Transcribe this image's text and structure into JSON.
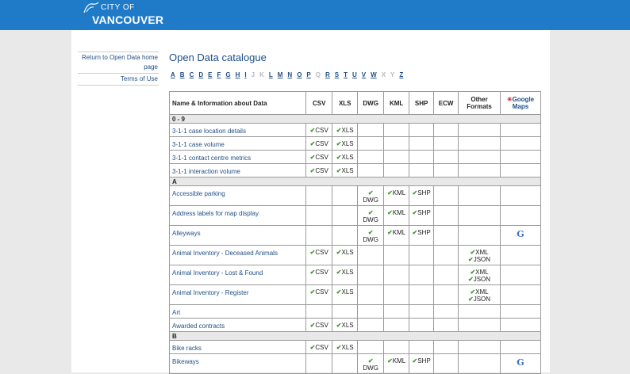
{
  "header": {
    "logo_top": "CITY OF",
    "logo_bottom": "VANCOUVER"
  },
  "sidebar": {
    "links": [
      "Return to Open Data home page",
      "Terms of Use"
    ]
  },
  "page_title": "Open Data catalogue",
  "alphabet": [
    {
      "l": "A",
      "on": true
    },
    {
      "l": "B",
      "on": true
    },
    {
      "l": "C",
      "on": true
    },
    {
      "l": "D",
      "on": true
    },
    {
      "l": "E",
      "on": true
    },
    {
      "l": "F",
      "on": true
    },
    {
      "l": "G",
      "on": true
    },
    {
      "l": "H",
      "on": true
    },
    {
      "l": "I",
      "on": true
    },
    {
      "l": "J",
      "on": false
    },
    {
      "l": "K",
      "on": false
    },
    {
      "l": "L",
      "on": true
    },
    {
      "l": "M",
      "on": true
    },
    {
      "l": "N",
      "on": true
    },
    {
      "l": "O",
      "on": true
    },
    {
      "l": "P",
      "on": true
    },
    {
      "l": "Q",
      "on": false
    },
    {
      "l": "R",
      "on": true
    },
    {
      "l": "S",
      "on": true
    },
    {
      "l": "T",
      "on": true
    },
    {
      "l": "U",
      "on": true
    },
    {
      "l": "V",
      "on": true
    },
    {
      "l": "W",
      "on": true
    },
    {
      "l": "X",
      "on": false
    },
    {
      "l": "Y",
      "on": false
    },
    {
      "l": "Z",
      "on": true
    }
  ],
  "table": {
    "headers": {
      "name": "Name & Information about Data",
      "csv": "CSV",
      "xls": "XLS",
      "dwg": "DWG",
      "kml": "KML",
      "shp": "SHP",
      "ecw": "ECW",
      "other": "Other Formats",
      "gmaps": "Google Maps"
    },
    "rows": [
      {
        "section": "0 - 9"
      },
      {
        "name": "3-1-1 case location details",
        "csv": "CSV",
        "xls": "XLS"
      },
      {
        "name": "3-1-1 case volume",
        "csv": "CSV",
        "xls": "XLS"
      },
      {
        "name": "3-1-1 contact centre metrics",
        "csv": "CSV",
        "xls": "XLS"
      },
      {
        "name": "3-1-1 interaction volume",
        "csv": "CSV",
        "xls": "XLS"
      },
      {
        "section": "A"
      },
      {
        "name": "Accessible parking",
        "dwg": "DWG",
        "kml": "KML",
        "shp": "SHP"
      },
      {
        "name": "Address labels for map display",
        "dwg": "DWG",
        "kml": "KML",
        "shp": "SHP"
      },
      {
        "name": "Alleyways",
        "dwg": "DWG",
        "kml": "KML",
        "shp": "SHP",
        "gmaps": "G"
      },
      {
        "name": "Animal Inventory - Deceased Animals",
        "csv": "CSV",
        "xls": "XLS",
        "other": [
          "XML",
          "JSON"
        ]
      },
      {
        "name": "Animal Inventory - Lost & Found",
        "csv": "CSV",
        "xls": "XLS",
        "other": [
          "XML",
          "JSON"
        ]
      },
      {
        "name": "Animal Inventory - Register",
        "csv": "CSV",
        "xls": "XLS",
        "other": [
          "XML",
          "JSON"
        ]
      },
      {
        "name": "Art"
      },
      {
        "name": "Awarded contracts",
        "csv": "CSV",
        "xls": "XLS"
      },
      {
        "section": "B"
      },
      {
        "name": "Bike racks",
        "csv": "CSV",
        "xls": "XLS"
      },
      {
        "name": "Bikeways",
        "dwg": "DWG",
        "kml": "KML",
        "shp": "SHP",
        "gmaps": "G"
      }
    ]
  },
  "colors": {
    "header_bar": "#1f7bc8",
    "check": "#3e9a2b",
    "link": "#1f4f86"
  }
}
